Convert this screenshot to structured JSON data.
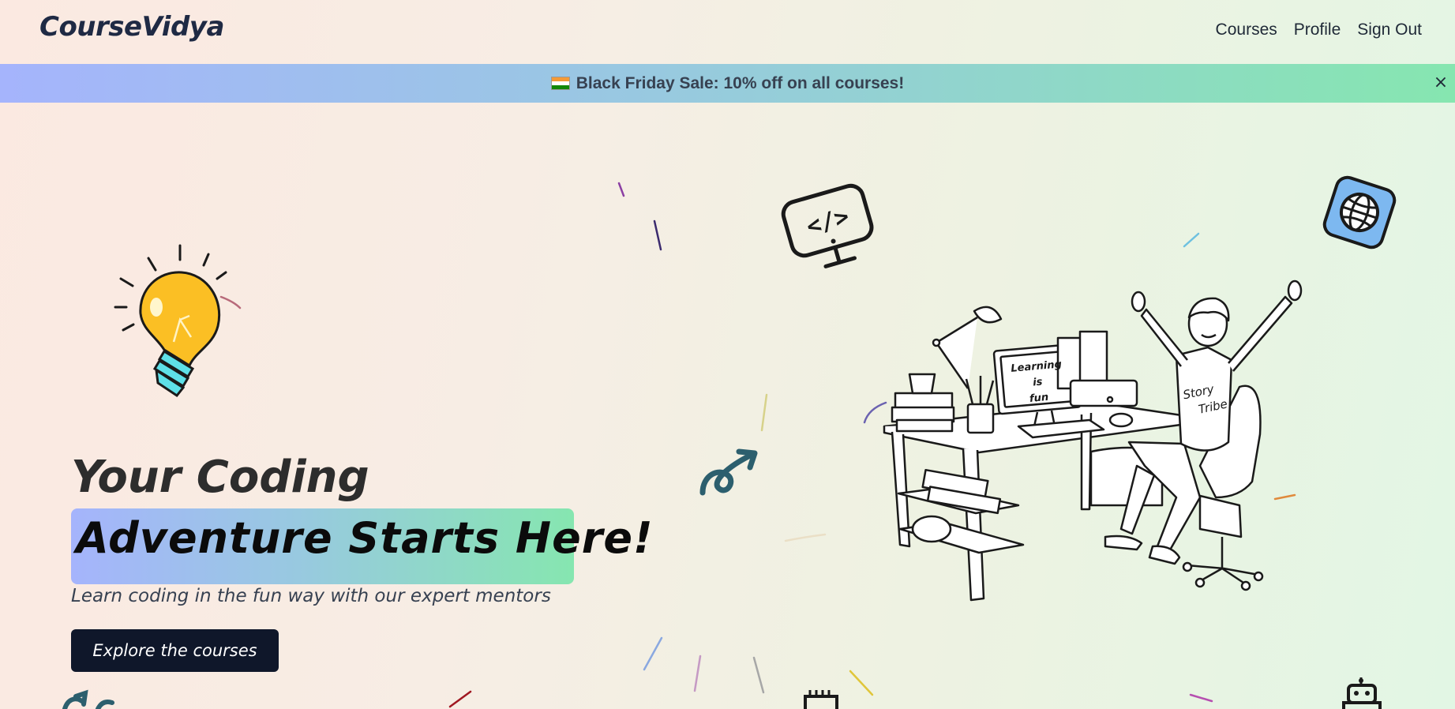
{
  "header": {
    "logo": "CourseVidya",
    "nav": [
      "Courses",
      "Profile",
      "Sign Out"
    ]
  },
  "banner": {
    "text": "Black Friday Sale: 10% off on all courses!",
    "close_label": "×"
  },
  "hero": {
    "title_line1": "Your Coding",
    "title_line2": "Adventure Starts Here!",
    "subtitle": "Learn coding in the fun way with our expert mentors",
    "cta": "Explore the courses"
  },
  "illustration": {
    "monitor_text": [
      "Learning",
      "is",
      "fun"
    ],
    "shirt_text": [
      "Story",
      "Tribe"
    ]
  },
  "colors": {
    "accent_gradient": [
      "#a5b4fc",
      "#86e6b0"
    ],
    "button_bg": "#0f172a",
    "bulb": "#fbbf24",
    "bulb_base": "#5ee0e8",
    "globe_bg": "#7db8f0"
  }
}
